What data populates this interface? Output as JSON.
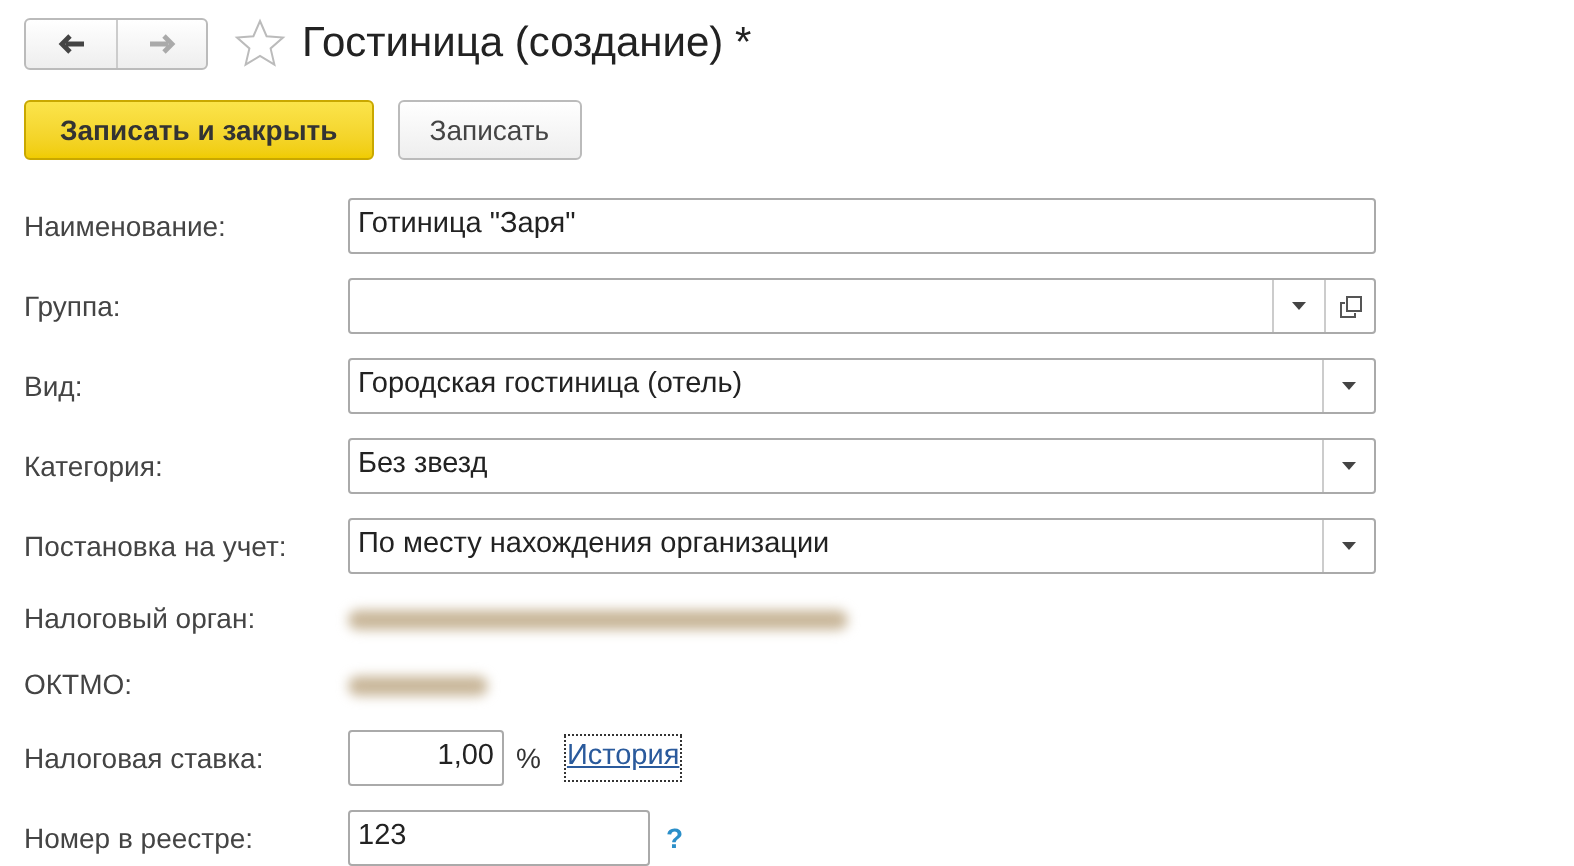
{
  "window": {
    "title": "Гостиница (создание) *",
    "favorite": false
  },
  "toolbar": {
    "buttons": [
      {
        "label": "Записать и закрыть",
        "kind": "primary"
      },
      {
        "label": "Записать",
        "kind": "normal"
      }
    ]
  },
  "fields": [
    {
      "label": "Наименование:",
      "kind": "text",
      "value": "Готиница \"Заря\""
    },
    {
      "label": "Группа:",
      "kind": "choice",
      "open_button": true
    },
    {
      "label": "Вид:",
      "kind": "choice",
      "value": "Городская гостиница (отель)",
      "open_button": false
    },
    {
      "label": "Категория:",
      "kind": "choice",
      "value": "Без звезд",
      "open_button": false
    },
    {
      "label": "Постановка на учет:",
      "kind": "choice",
      "value": "По месту нахождения организации",
      "open_button": false
    },
    {
      "label": "Налоговый орган:",
      "kind": "hidden"
    },
    {
      "label": "ОКТМО:",
      "kind": "hidden"
    },
    {
      "label": "Налоговая ставка:",
      "kind": "number",
      "value": "1,00",
      "unit": "%",
      "link": "История"
    },
    {
      "label": "Номер в реестре:",
      "kind": "short",
      "value": "123",
      "help": "?"
    }
  ]
}
